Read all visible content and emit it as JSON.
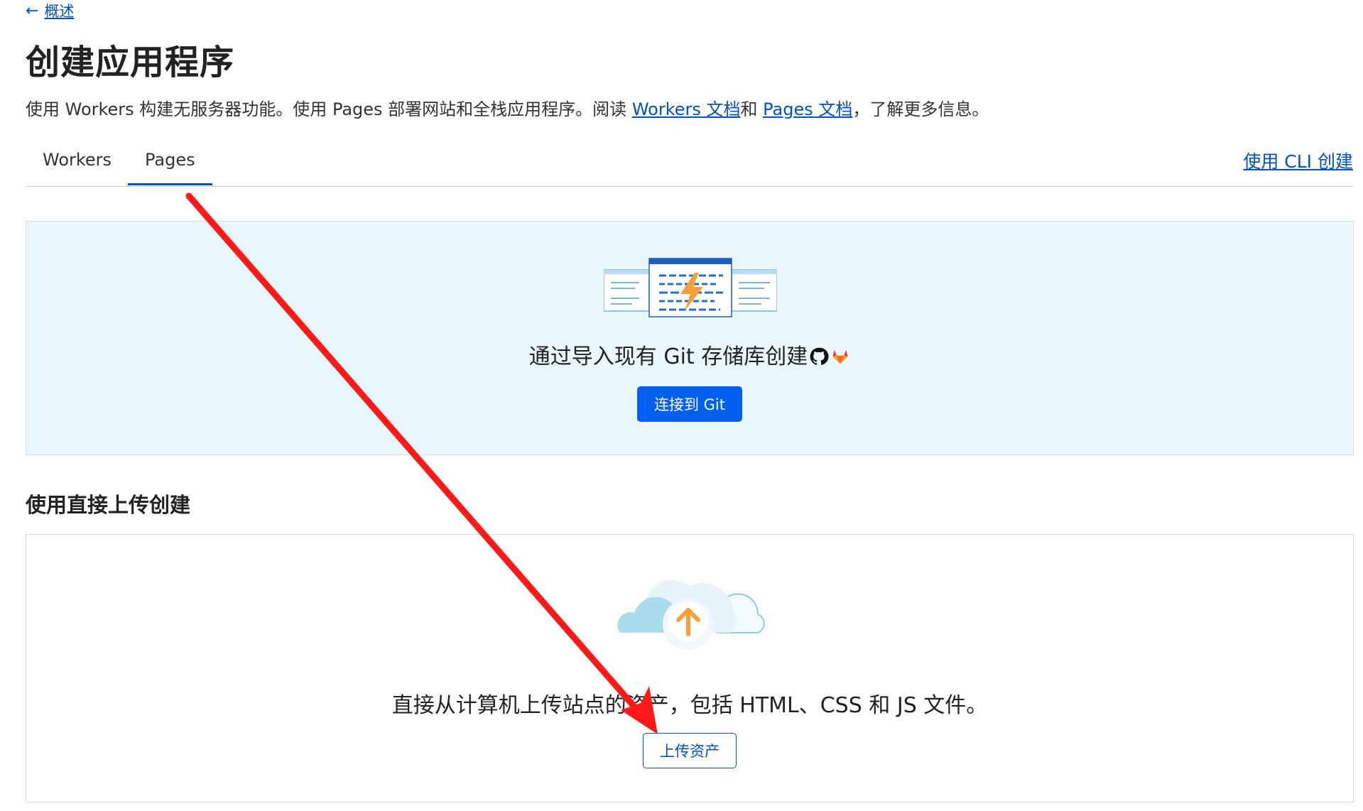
{
  "nav": {
    "back_label": "概述"
  },
  "header": {
    "title": "创建应用程序",
    "intro_prefix": "使用 Workers 构建无服务器功能。使用 Pages 部署网站和全栈应用程序。阅读 ",
    "workers_docs_link": "Workers 文档",
    "intro_and": "和 ",
    "pages_docs_link": "Pages 文档",
    "intro_suffix": "，了解更多信息。"
  },
  "tabs": [
    {
      "label": "Workers",
      "active": false
    },
    {
      "label": "Pages",
      "active": true
    }
  ],
  "cli_link": "使用 CLI 创建",
  "git_section": {
    "text": "通过导入现有 Git 存储库创建",
    "button_label": "连接到 Git",
    "icons": [
      "github-icon",
      "gitlab-icon"
    ]
  },
  "upload_section": {
    "title": "使用直接上传创建",
    "text": "直接从计算机上传站点的资产，包括 HTML、CSS 和 JS 文件。",
    "button_label": "上传资产"
  },
  "colors": {
    "accent": "#0051c3",
    "primary_button": "#0060f0",
    "git_panel_bg": "#e9f6fb",
    "annotation_arrow": "#ff1a1a",
    "upload_arrow": "#f6a03a"
  }
}
